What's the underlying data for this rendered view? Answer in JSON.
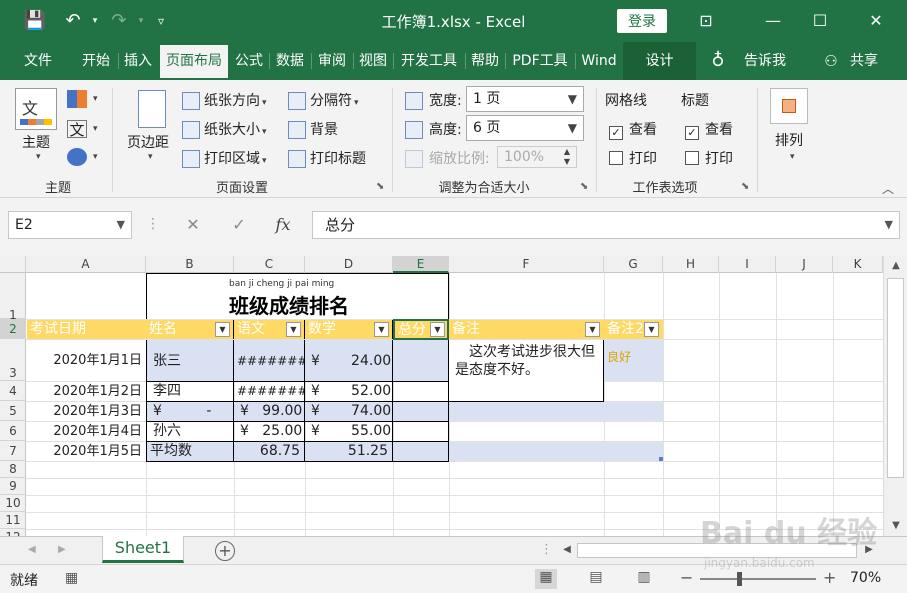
{
  "titlebar": {
    "title": "工作簿1.xlsx  -  Excel",
    "login": "登录"
  },
  "tabs": [
    "文件",
    "开始",
    "插入",
    "页面布局",
    "公式",
    "数据",
    "审阅",
    "视图",
    "开发工具",
    "帮助",
    "PDF工具",
    "Wind",
    "设计",
    "告诉我",
    "共享"
  ],
  "active_tab": "页面布局",
  "ribbon": {
    "themes": {
      "label": "主题",
      "group": "主题",
      "font_glyph": "文"
    },
    "page_setup": {
      "margins": "页边距",
      "orientation": "纸张方向",
      "size": "纸张大小",
      "print_area": "打印区域",
      "breaks": "分隔符",
      "background": "背景",
      "print_titles": "打印标题",
      "group": "页面设置"
    },
    "scale": {
      "width_label": "宽度:",
      "width_value": "1 页",
      "height_label": "高度:",
      "height_value": "6 页",
      "scale_label": "缩放比例:",
      "scale_value": "100%",
      "group": "调整为合适大小"
    },
    "sheet_options": {
      "gridlines": "网格线",
      "headings": "标题",
      "view": "查看",
      "print": "打印",
      "group": "工作表选项"
    },
    "arrange": {
      "label": "排列"
    }
  },
  "formula_bar": {
    "name_box": "E2",
    "formula": "总分"
  },
  "columns": [
    "A",
    "B",
    "C",
    "D",
    "E",
    "F",
    "G",
    "H",
    "I",
    "J",
    "K"
  ],
  "rows": [
    "1",
    "2",
    "3",
    "4",
    "5",
    "6",
    "7",
    "8",
    "9",
    "10",
    "11",
    "12"
  ],
  "sheet": {
    "pinyin": "ban ji cheng ji pai ming",
    "title": "班级成绩排名",
    "headers": [
      "考试日期",
      "姓名",
      "语文",
      "数学",
      "总分",
      "备注",
      "备注2"
    ],
    "data": [
      [
        "2020年1月1日",
        "张三",
        "########",
        "¥       24.00",
        "",
        "这次考试进步很大但是态度不好。",
        "良好"
      ],
      [
        "2020年1月2日",
        "李四",
        "########",
        "¥       52.00",
        "",
        "",
        ""
      ],
      [
        "2020年1月3日",
        "¥          -",
        "¥   99.00",
        "¥       74.00",
        "",
        "",
        ""
      ],
      [
        "2020年1月4日",
        "孙六",
        "¥   25.00",
        "¥       55.00",
        "",
        "",
        ""
      ],
      [
        "2020年1月5日",
        "平均数",
        "68.75",
        "51.25",
        "",
        "",
        ""
      ]
    ]
  },
  "sheet_tab": "Sheet1",
  "status": {
    "ready": "就绪",
    "zoom": "70%"
  },
  "watermark": {
    "brand": "Bai du 经验",
    "url": "jingyan.baidu.com"
  }
}
